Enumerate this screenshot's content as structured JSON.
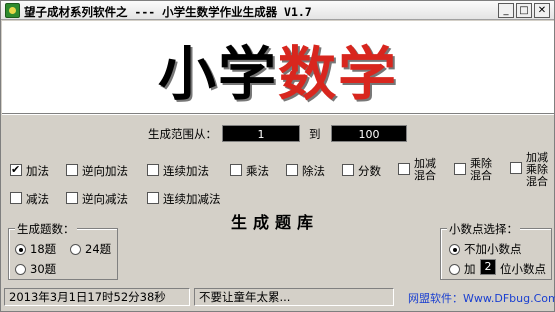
{
  "window": {
    "title": "望子成材系列软件之 --- 小学生数学作业生成器 V1.7",
    "minimize": "_",
    "maximize": "□",
    "close": "✕"
  },
  "banner": {
    "part1": "小学",
    "part2": "数学"
  },
  "range": {
    "label": "生成范围从：",
    "from": "1",
    "to_label": "到",
    "to": "100"
  },
  "operations": [
    {
      "label": "加法",
      "checked": true
    },
    {
      "label": "逆向加法",
      "checked": false
    },
    {
      "label": "连续加法",
      "checked": false
    },
    {
      "label": "乘法",
      "checked": false
    },
    {
      "label": "除法",
      "checked": false
    },
    {
      "label": "分数",
      "checked": false
    },
    {
      "label1": "加减",
      "label2": "混合",
      "checked": false
    },
    {
      "label1": "乘除",
      "label2": "混合",
      "checked": false
    },
    {
      "label1": "加减",
      "label2": "乘除",
      "label3": "混合",
      "checked": false
    },
    {
      "label": "减法",
      "checked": false
    },
    {
      "label": "逆向减法",
      "checked": false
    },
    {
      "label": "连续加减法",
      "checked": false
    }
  ],
  "count_group": {
    "title": "生成题数：",
    "options": [
      {
        "label": "18题",
        "selected": true
      },
      {
        "label": "24题",
        "selected": false
      },
      {
        "label": "30题",
        "selected": false
      }
    ]
  },
  "generate_button": "生成题库",
  "decimal_group": {
    "title": "小数点选择：",
    "no_decimal": "不加小数点",
    "add_prefix": "加",
    "digits": "2",
    "add_suffix": "位小数点"
  },
  "status": {
    "datetime": "2013年3月1日17时52分38秒",
    "message": "不要让童年太累...",
    "link": "网盟软件：Www.DFbug.Com"
  }
}
